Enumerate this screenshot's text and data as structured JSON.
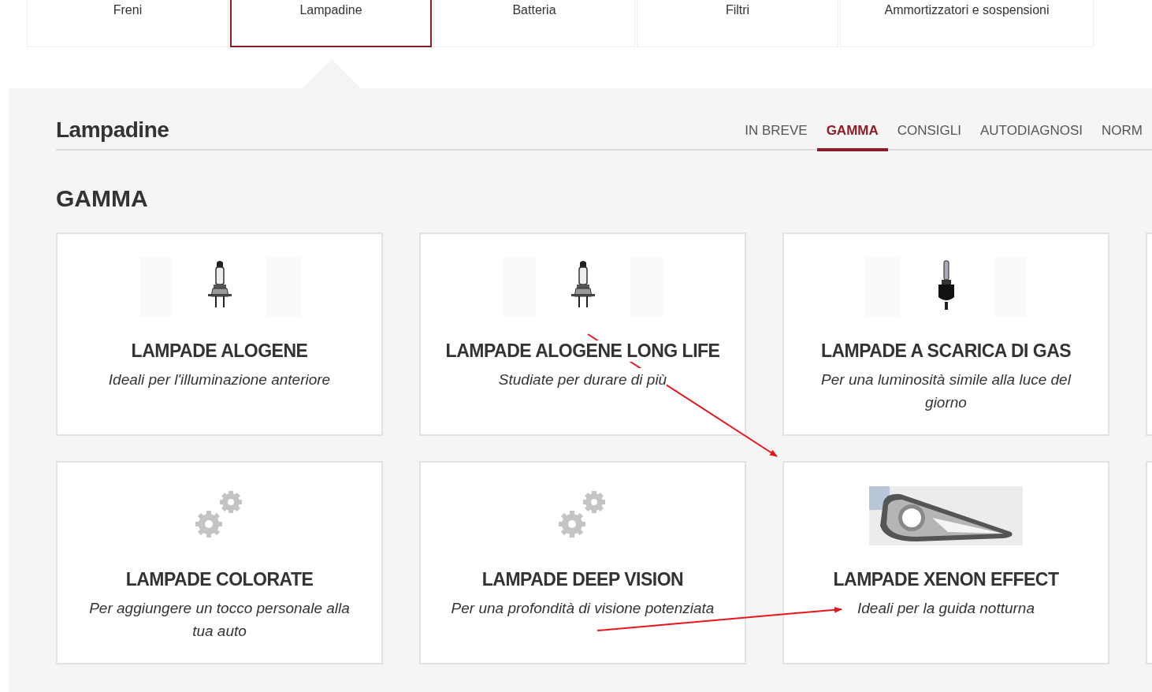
{
  "category_tabs": [
    {
      "label": "Freni",
      "selected": false
    },
    {
      "label": "Lampadine",
      "selected": true
    },
    {
      "label": "Batteria",
      "selected": false
    },
    {
      "label": "Filtri",
      "selected": false
    },
    {
      "label": "Ammortizzatori e sospensioni",
      "selected": false
    }
  ],
  "section": {
    "title": "Lampadine",
    "nav": [
      {
        "label": "IN BREVE",
        "selected": false
      },
      {
        "label": "GAMMA",
        "selected": true
      },
      {
        "label": "CONSIGLI",
        "selected": false
      },
      {
        "label": "AUTODIAGNOSI",
        "selected": false
      },
      {
        "label": "NORM",
        "selected": false
      }
    ]
  },
  "heading": "GAMMA",
  "products": [
    {
      "kind": "bulb",
      "title": "LAMPADE ALOGENE",
      "subtitle": "Ideali per l'illuminazione anteriore"
    },
    {
      "kind": "bulb",
      "title": "LAMPADE ALOGENE LONG LIFE",
      "subtitle": "Studiate per durare di più"
    },
    {
      "kind": "gas-bulb",
      "title": "LAMPADE A SCARICA DI GAS",
      "subtitle": "Per una luminosità simile alla luce del giorno"
    },
    {
      "kind": "gears",
      "title": "LAMPADE COLORATE",
      "subtitle": "Per aggiungere un tocco personale alla tua auto"
    },
    {
      "kind": "gears",
      "title": "LAMPADE DEEP VISION",
      "subtitle": "Per una profondità di visione potenziata"
    },
    {
      "kind": "picture",
      "title": "LAMPADE XENON EFFECT",
      "subtitle": "Ideali per la guida notturna"
    }
  ]
}
